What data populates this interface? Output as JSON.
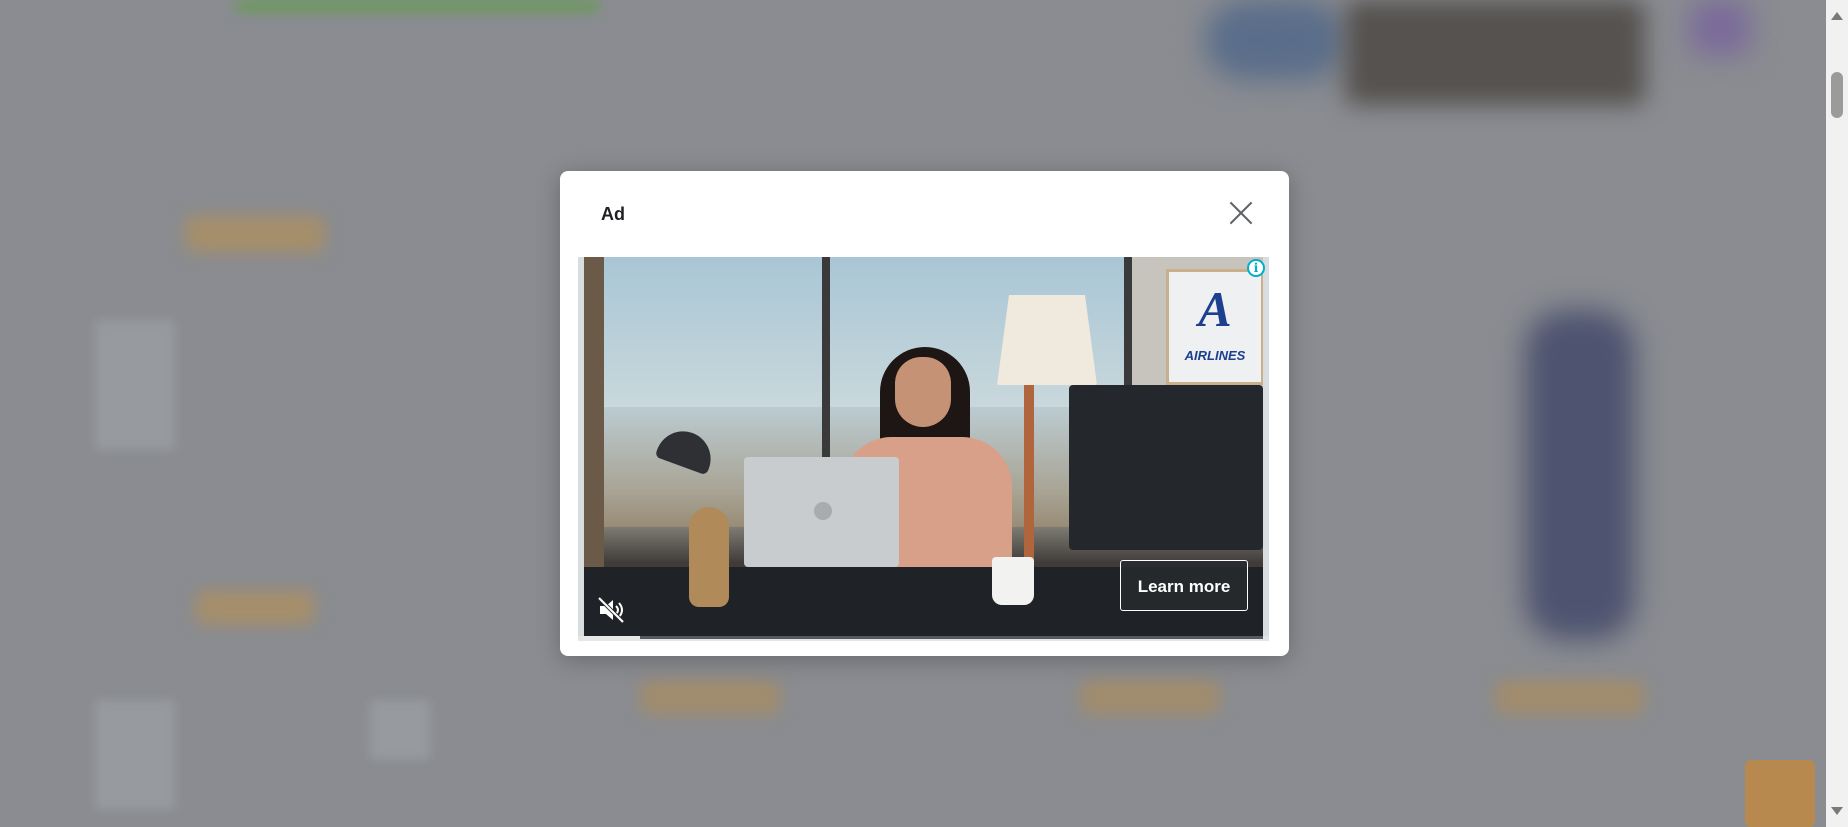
{
  "modal": {
    "title": "Ad",
    "close_icon": "close-icon"
  },
  "ad": {
    "info_icon": "info-icon",
    "info_glyph": "i",
    "mute_icon": "muted-speaker-icon",
    "learn_more_label": "Learn more",
    "progress": 0.09,
    "poster": {
      "logo_letter": "A",
      "brand_text": "AIRLINES"
    }
  },
  "colors": {
    "overlay": "#8a8c91",
    "modal_bg": "#ffffff",
    "info_accent": "#00aecd",
    "button_bg": "#282a2d"
  },
  "scrollbar": {
    "up_icon": "scroll-up-arrow-icon",
    "down_icon": "scroll-down-arrow-icon"
  }
}
